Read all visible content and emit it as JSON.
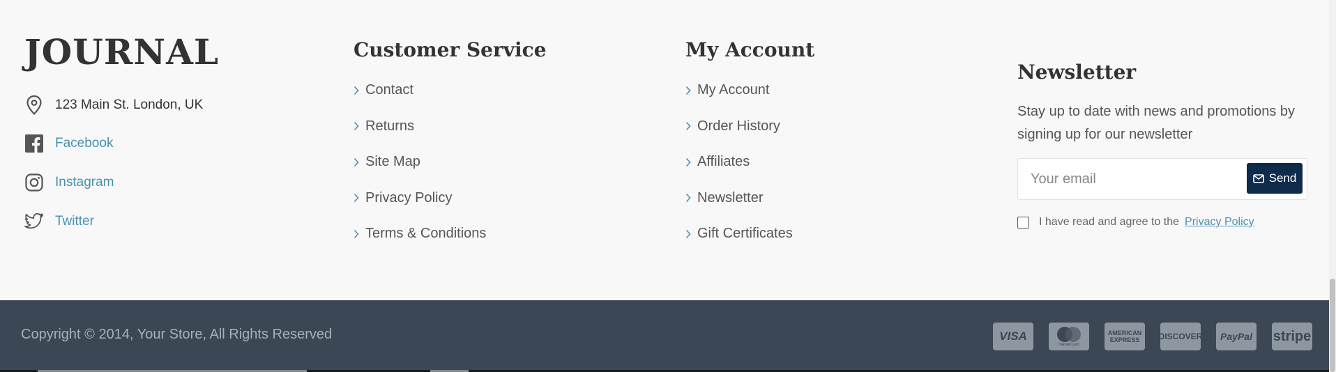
{
  "brand": {
    "logo_text": "JOURNAL"
  },
  "contact": {
    "address": "123 Main St. London, UK",
    "social": [
      {
        "label": "Facebook",
        "icon": "facebook-icon"
      },
      {
        "label": "Instagram",
        "icon": "instagram-icon"
      },
      {
        "label": "Twitter",
        "icon": "twitter-icon"
      }
    ]
  },
  "customer_service": {
    "title": "Customer Service",
    "links": [
      "Contact",
      "Returns",
      "Site Map",
      "Privacy Policy",
      "Terms & Conditions"
    ]
  },
  "my_account": {
    "title": "My Account",
    "links": [
      "My Account",
      "Order History",
      "Affiliates",
      "Newsletter",
      "Gift Certificates"
    ]
  },
  "newsletter": {
    "title": "Newsletter",
    "description": "Stay up to date with news and promotions by signing up for our newsletter",
    "email_placeholder": "Your email",
    "send_label": "Send",
    "agree_text": "I have read and agree to the",
    "privacy_link": "Privacy Policy"
  },
  "bottom_bar": {
    "copyright": "Copyright © 2014, Your Store, All Rights Reserved",
    "payments": [
      "VISA",
      "mastercard",
      "AMERICAN EXPRESS",
      "DISCOVER",
      "PayPal",
      "stripe"
    ]
  },
  "colors": {
    "accent": "#4a90b3",
    "button": "#0f2b4b",
    "bottom_bar": "#3b4754",
    "background": "#f8f8f8"
  }
}
